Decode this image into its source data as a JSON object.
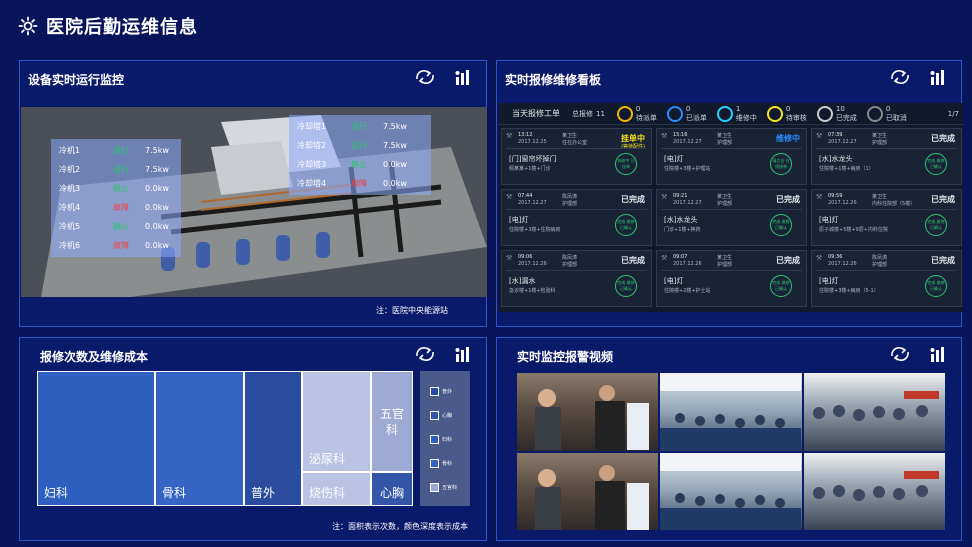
{
  "header": {
    "title": "医院后勤运维信息",
    "logo_icon": "gear-icon"
  },
  "colors": {
    "bg": "#08155a",
    "panel": "#0a1a6a",
    "border": "#2d54c8",
    "green": "#29c96e",
    "red": "#ff3a3a",
    "yellow": "#f5e322",
    "blue": "#2a8cff"
  },
  "p1": {
    "title": "设备实时运行监控",
    "note": "注：医院中央能源站",
    "chillers": [
      {
        "name": "冷机1",
        "status": "运行",
        "color": "#29c96e",
        "power": "7.5kw"
      },
      {
        "name": "冷机2",
        "status": "运行",
        "color": "#29c96e",
        "power": "7.5kw"
      },
      {
        "name": "冷机3",
        "status": "静止",
        "color": "#29c96e",
        "power": "0.0kw"
      },
      {
        "name": "冷机4",
        "status": "故障",
        "color": "#ff3a3a",
        "power": "0.0kw"
      },
      {
        "name": "冷机5",
        "status": "静止",
        "color": "#29c96e",
        "power": "0.0kw"
      },
      {
        "name": "冷机6",
        "status": "故障",
        "color": "#ff3a3a",
        "power": "0.0kw"
      }
    ],
    "towers": [
      {
        "name": "冷却塔1",
        "status": "运行",
        "color": "#29c96e",
        "power": "7.5kw"
      },
      {
        "name": "冷却塔2",
        "status": "运行",
        "color": "#29c96e",
        "power": "7.5kw"
      },
      {
        "name": "冷却塔3",
        "status": "静止",
        "color": "#29c96e",
        "power": "0.0kw"
      },
      {
        "name": "冷却塔4",
        "status": "故障",
        "color": "#ff3a3a",
        "power": "0.0kw"
      }
    ]
  },
  "p2": {
    "title": "实时报修维修看板",
    "tab": "当天报修工单",
    "total_label": "总报修",
    "total": "11",
    "stats": [
      {
        "n": "0",
        "label": "待派单",
        "color": "#f5b400"
      },
      {
        "n": "0",
        "label": "已派单",
        "color": "#2a8cff"
      },
      {
        "n": "1",
        "label": "维修中",
        "color": "#2ad0ff"
      },
      {
        "n": "0",
        "label": "待审核",
        "color": "#f5e322"
      },
      {
        "n": "10",
        "label": "已完成",
        "color": "#cccccc"
      },
      {
        "n": "0",
        "label": "已取消",
        "color": "#888888"
      }
    ],
    "page": "1/7",
    "cards": [
      {
        "time": "13:12",
        "date": "2017.12.25",
        "by": "某卫生\n住在办公室",
        "status": "挂单中",
        "sub_status": "(等待配件)",
        "scolor": "#f5e322",
        "title": "[门]窗帘坏掉门",
        "desc": "佩某某+1楼+门诊",
        "seal": "协助中 已挂单"
      },
      {
        "time": "15:16",
        "date": "2017.12.27",
        "by": "某卫生\n护理部",
        "status": "维修中",
        "sub_status": "",
        "scolor": "#2a8cff",
        "title": "[电]灯",
        "desc": "住院楼+3楼+护理站",
        "seal": "请点击 在线接单"
      },
      {
        "time": "07:39",
        "date": "2017.12.27",
        "by": "某卫生\n护理部",
        "status": "已完成",
        "sub_status": "",
        "scolor": "#e6e9ef",
        "title": "[水]水龙头",
        "desc": "住院楼+1楼+病房（1）",
        "seal": "完成 维修已确认"
      },
      {
        "time": "07:44",
        "date": "2017.12.27",
        "by": "陈凤涛\n护理部",
        "status": "已完成",
        "sub_status": "",
        "scolor": "#e6e9ef",
        "title": "[电]灯",
        "desc": "住院楼+3楼+住院病房",
        "seal": "完成 维修已确认"
      },
      {
        "time": "09:21",
        "date": "2017.12.27",
        "by": "某卫生\n护理部",
        "status": "已完成",
        "sub_status": "",
        "scolor": "#e6e9ef",
        "title": "[水]水龙头",
        "desc": "门诊+1楼+换药",
        "seal": "完成 维修已确认"
      },
      {
        "time": "09:59",
        "date": "2017.12.26",
        "by": "某卫生\n内科住院部（5楼）",
        "status": "已完成",
        "sub_status": "",
        "scolor": "#e6e9ef",
        "title": "[电]灯",
        "desc": "原子城楼+5楼+9层+内科住院",
        "seal": "完成 维修已确认"
      },
      {
        "time": "09:06",
        "date": "2017.12.26",
        "by": "陈凤涛\n护理部",
        "status": "已完成",
        "sub_status": "",
        "scolor": "#e6e9ef",
        "title": "[水]漏水",
        "desc": "急诊楼+1楼+检验科",
        "seal": "完成 维修已确认"
      },
      {
        "time": "09:07",
        "date": "2017.12.26",
        "by": "某卫生\n护理部",
        "status": "已完成",
        "sub_status": "",
        "scolor": "#e6e9ef",
        "title": "[电]灯",
        "desc": "住院楼+2楼+护士站",
        "seal": "完成 维修已确认"
      },
      {
        "time": "09:36",
        "date": "2017.12.26",
        "by": "陈凤涛\n护理部",
        "status": "已完成",
        "sub_status": "",
        "scolor": "#e6e9ef",
        "title": "[电]灯",
        "desc": "住院楼+3楼+病房（5-1）",
        "seal": "完成 维修已确认"
      }
    ]
  },
  "p3": {
    "title": "报修次数及维修成本",
    "note": "注：面积表示次数，颜色深度表示成本",
    "cells": [
      {
        "label": "妇科",
        "color": "#2f5fc0"
      },
      {
        "label": "骨科",
        "color": "#3564c4"
      },
      {
        "label": "普外",
        "color": "#2a4c9e"
      },
      {
        "label": "泌尿科",
        "color": "#b9c3e3"
      },
      {
        "label": "五官科",
        "color": "#9daad6"
      },
      {
        "label": "烧伤科",
        "color": "#b9c3e3"
      },
      {
        "label": "心胸",
        "color": "#3356a8"
      }
    ],
    "legend": [
      {
        "label": "普外",
        "color": "#2a4c9e"
      },
      {
        "label": "心胸",
        "color": "#3356a8"
      },
      {
        "label": "妇科",
        "color": "#2f5fc0"
      },
      {
        "label": "骨科",
        "color": "#3564c4"
      },
      {
        "label": "五官科",
        "color": "#9daad6"
      }
    ]
  },
  "p4": {
    "title": "实时监控报警视频"
  }
}
